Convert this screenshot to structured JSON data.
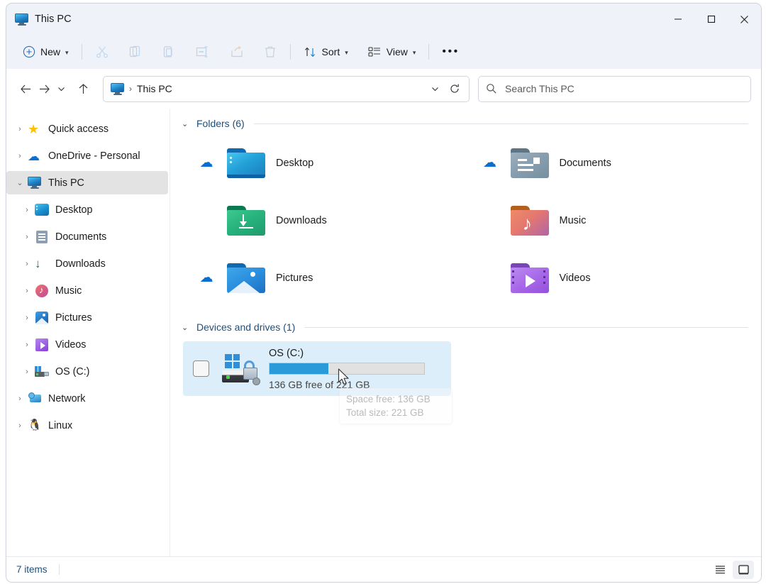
{
  "window": {
    "title": "This PC",
    "title_icon": "this-pc-monitor-icon",
    "controls": {
      "minimize": "─",
      "maximize": "□",
      "close": "✕"
    }
  },
  "toolbar": {
    "new_label": "New",
    "sort_label": "Sort",
    "view_label": "View",
    "more_label": "•••",
    "items": [
      {
        "name": "cut",
        "icon": "scissors-icon",
        "disabled": true
      },
      {
        "name": "copy",
        "icon": "copy-icon",
        "disabled": true
      },
      {
        "name": "paste",
        "icon": "paste-icon",
        "disabled": true
      },
      {
        "name": "rename",
        "icon": "rename-icon",
        "disabled": true
      },
      {
        "name": "share",
        "icon": "share-icon",
        "disabled": true
      },
      {
        "name": "delete",
        "icon": "trash-icon",
        "disabled": true
      }
    ]
  },
  "navbar": {
    "back": "back-arrow-icon",
    "forward": "forward-arrow-icon",
    "recent": "chevron-down-icon",
    "up": "up-arrow-icon",
    "breadcrumb": {
      "icon": "this-pc-monitor-icon",
      "separator": "›",
      "text": "This PC"
    },
    "dropdown": "chevron-down-icon",
    "refresh": "refresh-icon"
  },
  "search": {
    "placeholder": "Search This PC",
    "icon": "search-icon"
  },
  "sidebar": {
    "items": [
      {
        "label": "Quick access",
        "icon": "star-icon",
        "chevron": "›",
        "indent": 0,
        "selected": false
      },
      {
        "label": "OneDrive - Personal",
        "icon": "onedrive-cloud-icon",
        "chevron": "›",
        "indent": 0,
        "selected": false
      },
      {
        "label": "This PC",
        "icon": "this-pc-monitor-icon",
        "chevron": "⌄",
        "indent": 0,
        "selected": true
      },
      {
        "label": "Desktop",
        "icon": "desktop-folder-icon",
        "chevron": "›",
        "indent": 1,
        "selected": false
      },
      {
        "label": "Documents",
        "icon": "documents-folder-icon",
        "chevron": "›",
        "indent": 1,
        "selected": false
      },
      {
        "label": "Downloads",
        "icon": "downloads-folder-icon",
        "chevron": "›",
        "indent": 1,
        "selected": false
      },
      {
        "label": "Music",
        "icon": "music-folder-icon",
        "chevron": "›",
        "indent": 1,
        "selected": false
      },
      {
        "label": "Pictures",
        "icon": "pictures-folder-icon",
        "chevron": "›",
        "indent": 1,
        "selected": false
      },
      {
        "label": "Videos",
        "icon": "videos-folder-icon",
        "chevron": "›",
        "indent": 1,
        "selected": false
      },
      {
        "label": "OS (C:)",
        "icon": "drive-icon",
        "chevron": "›",
        "indent": 1,
        "selected": false
      },
      {
        "label": "Network",
        "icon": "network-icon",
        "chevron": "›",
        "indent": 0,
        "selected": false
      },
      {
        "label": "Linux",
        "icon": "linux-penguin-icon",
        "chevron": "›",
        "indent": 0,
        "selected": false
      }
    ]
  },
  "content": {
    "groups": [
      {
        "title": "Folders (6)",
        "chevron": "⌄"
      },
      {
        "title": "Devices and drives (1)",
        "chevron": "⌄"
      }
    ],
    "folders": [
      {
        "label": "Desktop",
        "icon": "desktop-folder-icon",
        "cloud": "cloud-status-icon"
      },
      {
        "label": "Documents",
        "icon": "documents-folder-icon",
        "cloud": "cloud-status-icon"
      },
      {
        "label": "Downloads",
        "icon": "downloads-folder-icon",
        "cloud": ""
      },
      {
        "label": "Music",
        "icon": "music-folder-icon",
        "cloud": ""
      },
      {
        "label": "Pictures",
        "icon": "pictures-folder-icon",
        "cloud": "cloud-status-icon"
      },
      {
        "label": "Videos",
        "icon": "videos-folder-icon",
        "cloud": ""
      }
    ],
    "drive": {
      "name": "OS (C:)",
      "capacity_text": "136 GB free of 221 GB",
      "free_gb": 136,
      "total_gb": 221,
      "used_percent": 38,
      "bar_color": "#2b9ad8",
      "selected": true,
      "selection_color": "#ddeefb"
    },
    "tooltip": {
      "line1": "Space free: 136 GB",
      "line2": "Total size: 221 GB"
    }
  },
  "statusbar": {
    "item_count": "7 items",
    "views": [
      {
        "name": "details-view-button",
        "icon": "list-lines-icon",
        "active": false
      },
      {
        "name": "large-icons-view-button",
        "icon": "large-icon-square-icon",
        "active": true
      }
    ]
  }
}
